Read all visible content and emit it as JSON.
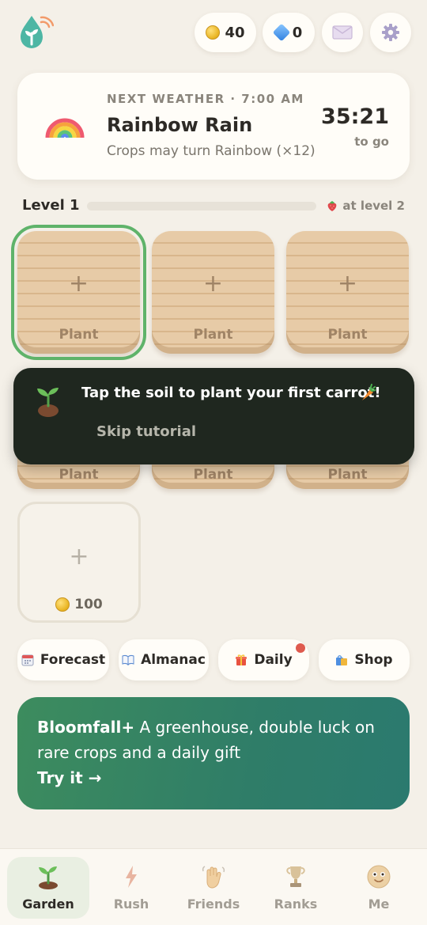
{
  "header": {
    "coins": "40",
    "gems": "0",
    "icons": [
      "app-logo-icon",
      "coin-icon",
      "gem-icon",
      "mail-icon",
      "gear-icon"
    ]
  },
  "weather": {
    "kicker": "NEXT WEATHER · 7:00 AM",
    "title": "Rainbow Rain",
    "subtitle": "Crops may turn Rainbow (×12)",
    "countdown": "35:21",
    "countdown_suffix": "to go",
    "icon": "rainbow-icon"
  },
  "level": {
    "label": "Level 1",
    "progress": 0,
    "reward_text": "at level 2",
    "reward_icon": "strawberry-icon"
  },
  "plots": {
    "plot_label": "Plant",
    "count_full": 3,
    "count_partial": 3,
    "buy_price": "100"
  },
  "tutorial": {
    "message": "Tap the soil to plant your first carrot!",
    "skip_label": "Skip tutorial",
    "icons": [
      "sprout-icon",
      "carrot-icon"
    ]
  },
  "actions": [
    {
      "label": "Forecast",
      "icon": "calendar-icon"
    },
    {
      "label": "Almanac",
      "icon": "book-icon"
    },
    {
      "label": "Daily",
      "icon": "gift-icon",
      "has_notification": true
    },
    {
      "label": "Shop",
      "icon": "shopping-bag-icon"
    }
  ],
  "promo": {
    "brand": "Bloomfall+",
    "text": "A greenhouse, double luck on rare crops and a daily gift",
    "cta": "Try it →"
  },
  "nav": [
    {
      "label": "Garden",
      "icon": "sprout-icon",
      "active": true
    },
    {
      "label": "Rush",
      "icon": "lightning-icon",
      "active": false
    },
    {
      "label": "Friends",
      "icon": "waving-hand-icon",
      "active": false
    },
    {
      "label": "Ranks",
      "icon": "trophy-icon",
      "active": false
    },
    {
      "label": "Me",
      "icon": "face-icon",
      "active": false
    }
  ],
  "colors": {
    "background": "#f4f0e8",
    "accent_green": "#5fb36a",
    "promo_green": "#3d8c5e",
    "tutorial_bg": "#1f271f",
    "notification": "#de5a4e"
  }
}
